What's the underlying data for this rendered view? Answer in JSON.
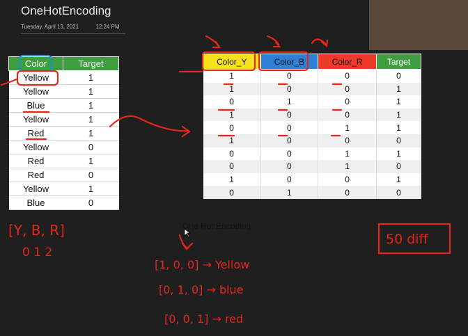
{
  "page": {
    "title": "OneHotEncoding",
    "date": "Tuesday, April 13, 2021",
    "time": "12:24 PM"
  },
  "table1": {
    "headers": [
      "Color",
      "Target"
    ],
    "rows": [
      [
        "Yellow",
        "1"
      ],
      [
        "Yellow",
        "1"
      ],
      [
        "Blue",
        "1"
      ],
      [
        "Yellow",
        "1"
      ],
      [
        "Red",
        "1"
      ],
      [
        "Yellow",
        "0"
      ],
      [
        "Red",
        "1"
      ],
      [
        "Red",
        "0"
      ],
      [
        "Yellow",
        "1"
      ],
      [
        "Blue",
        "0"
      ]
    ]
  },
  "table2": {
    "headers": [
      "Color_Y",
      "Color_B",
      "Color_R",
      "Target"
    ],
    "rows": [
      [
        "1",
        "0",
        "0",
        "0"
      ],
      [
        "1",
        "0",
        "0",
        "1"
      ],
      [
        "0",
        "1",
        "0",
        "1"
      ],
      [
        "1",
        "0",
        "0",
        "1"
      ],
      [
        "0",
        "0",
        "1",
        "1"
      ],
      [
        "1",
        "0",
        "0",
        "0"
      ],
      [
        "0",
        "0",
        "1",
        "1"
      ],
      [
        "0",
        "0",
        "1",
        "0"
      ],
      [
        "1",
        "0",
        "0",
        "1"
      ],
      [
        "0",
        "1",
        "0",
        "0"
      ]
    ]
  },
  "caption": "One Hot Encoding",
  "annotations": {
    "categories": "[Y, B, R]",
    "codes": "0   1   2",
    "enc_yellow": "[1, 0, 0] → Yellow",
    "enc_blue": "[0, 1, 0] → blue",
    "enc_red": "[0, 0, 1] → red",
    "note": "50 diff"
  },
  "colors": {
    "ink": "#e4261d",
    "green": "#3f9e3f",
    "yellow": "#f7e11c",
    "blue": "#2f7fd6",
    "red": "#ee3a2a"
  }
}
